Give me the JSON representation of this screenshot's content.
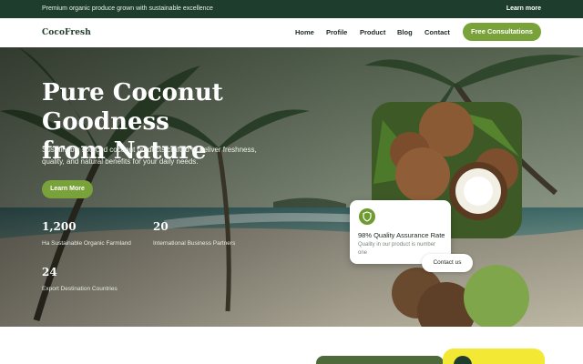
{
  "topbar": {
    "message": "Premium organic produce grown with sustainable excellence",
    "link": "Learn more"
  },
  "nav": {
    "logo": "CocoFresh",
    "items": [
      "Home",
      "Profile",
      "Product",
      "Blog",
      "Contact"
    ],
    "cta": "Free Consultations"
  },
  "hero": {
    "title_line1": "Pure Coconut Goodness",
    "title_line2": "from Nature",
    "lead": "Sustainably sourced coconut products crafted to deliver freshness, quality, and natural benefits for your daily needs.",
    "button": "Learn More",
    "stats": [
      {
        "value": "1,200",
        "label": "Ha Sustainable Organic Farmland"
      },
      {
        "value": "20",
        "label": "International Business Partners"
      },
      {
        "value": "24",
        "label": "Export Destination Countries"
      }
    ]
  },
  "quality_card": {
    "title": "98% Quality Assurance Rate",
    "description": "Quality in our product is number one",
    "contact": "Contact us"
  },
  "colors": {
    "dark_green": "#1f3d2c",
    "accent_green": "#7aa23a",
    "yellow": "#f3e834"
  }
}
